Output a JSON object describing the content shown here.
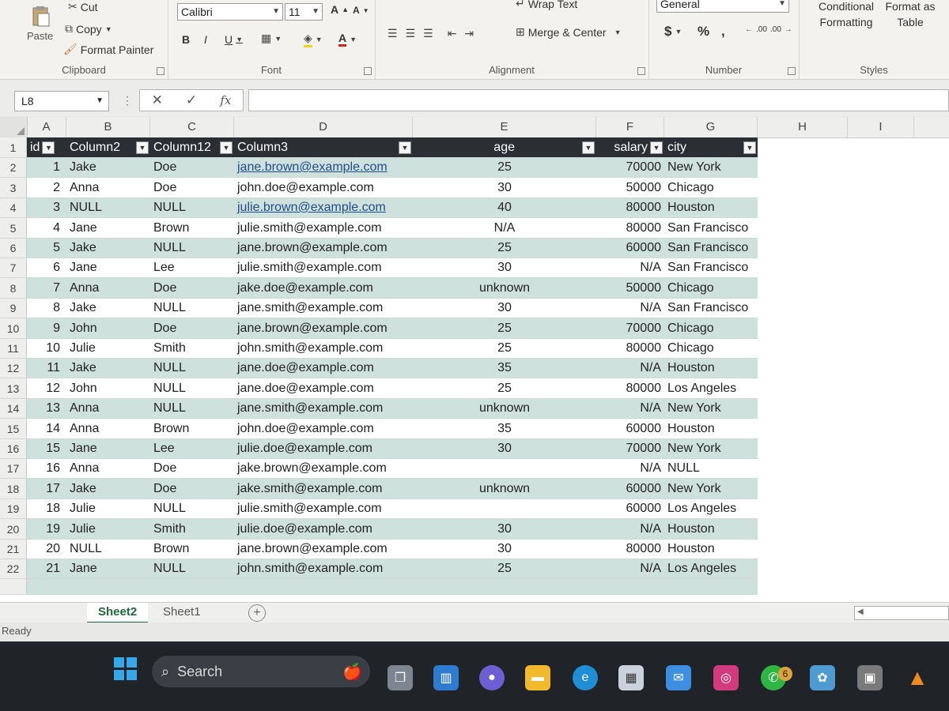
{
  "ribbon": {
    "clipboard": {
      "paste": "Paste",
      "cut": "Cut",
      "copy": "Copy",
      "format_painter": "Format Painter",
      "label": "Clipboard"
    },
    "font": {
      "name": "Calibri",
      "size": "11",
      "label": "Font",
      "bold": "B",
      "italic": "I",
      "underline": "U",
      "grow": "A",
      "shrink": "A",
      "font_color": "A"
    },
    "alignment": {
      "wrap_text": "Wrap Text",
      "merge_center": "Merge & Center",
      "label": "Alignment"
    },
    "number": {
      "format": "General",
      "currency": "$",
      "percent": "%",
      "comma": ",",
      "inc_decimal": ".00",
      "dec_decimal": ".00",
      "label": "Number"
    },
    "styles": {
      "conditional_formatting": "Conditional Formatting",
      "format_as_table": "Format as Table",
      "label": "Styles"
    }
  },
  "formula_bar": {
    "name_box": "L8",
    "cancel": "✕",
    "enter": "✓",
    "fx": "fx",
    "value": ""
  },
  "columns": [
    "A",
    "B",
    "C",
    "D",
    "E",
    "F",
    "G",
    "H",
    "I"
  ],
  "table": {
    "headers": {
      "id": "id",
      "col2": "Column2",
      "col12": "Column12",
      "col3": "Column3",
      "age": "age",
      "salary": "salary",
      "city": "city"
    },
    "rows": [
      {
        "n": "2",
        "id": "1",
        "c2": "Jake",
        "c12": "Doe",
        "email": "jane.brown@example.com",
        "age": "25",
        "salary": "70000",
        "city": "New York"
      },
      {
        "n": "3",
        "id": "2",
        "c2": "Anna",
        "c12": "Doe",
        "email": "john.doe@example.com",
        "age": "30",
        "salary": "50000",
        "city": "Chicago"
      },
      {
        "n": "4",
        "id": "3",
        "c2": "NULL",
        "c12": "NULL",
        "email": "julie.brown@example.com",
        "age": "40",
        "salary": "80000",
        "city": "Houston"
      },
      {
        "n": "5",
        "id": "4",
        "c2": "Jane",
        "c12": "Brown",
        "email": "julie.smith@example.com",
        "age": "N/A",
        "salary": "80000",
        "city": "San Francisco"
      },
      {
        "n": "6",
        "id": "5",
        "c2": "Jake",
        "c12": "NULL",
        "email": "jane.brown@example.com",
        "age": "25",
        "salary": "60000",
        "city": "San Francisco"
      },
      {
        "n": "7",
        "id": "6",
        "c2": "Jane",
        "c12": "Lee",
        "email": "julie.smith@example.com",
        "age": "30",
        "salary": "N/A",
        "city": "San Francisco"
      },
      {
        "n": "8",
        "id": "7",
        "c2": "Anna",
        "c12": "Doe",
        "email": "jake.doe@example.com",
        "age": "unknown",
        "salary": "50000",
        "city": "Chicago"
      },
      {
        "n": "9",
        "id": "8",
        "c2": "Jake",
        "c12": "NULL",
        "email": "jane.smith@example.com",
        "age": "30",
        "salary": "N/A",
        "city": "San Francisco"
      },
      {
        "n": "10",
        "id": "9",
        "c2": "John",
        "c12": "Doe",
        "email": "jane.brown@example.com",
        "age": "25",
        "salary": "70000",
        "city": "Chicago"
      },
      {
        "n": "11",
        "id": "10",
        "c2": "Julie",
        "c12": "Smith",
        "email": "john.smith@example.com",
        "age": "25",
        "salary": "80000",
        "city": "Chicago"
      },
      {
        "n": "12",
        "id": "11",
        "c2": "Jake",
        "c12": "NULL",
        "email": "jane.doe@example.com",
        "age": "35",
        "salary": "N/A",
        "city": "Houston"
      },
      {
        "n": "13",
        "id": "12",
        "c2": "John",
        "c12": "NULL",
        "email": "jane.doe@example.com",
        "age": "25",
        "salary": "80000",
        "city": "Los Angeles"
      },
      {
        "n": "14",
        "id": "13",
        "c2": "Anna",
        "c12": "NULL",
        "email": "jane.smith@example.com",
        "age": "unknown",
        "salary": "N/A",
        "city": "New York"
      },
      {
        "n": "15",
        "id": "14",
        "c2": "Anna",
        "c12": "Brown",
        "email": "john.doe@example.com",
        "age": "35",
        "salary": "60000",
        "city": "Houston"
      },
      {
        "n": "16",
        "id": "15",
        "c2": "Jane",
        "c12": "Lee",
        "email": "julie.doe@example.com",
        "age": "30",
        "salary": "70000",
        "city": "New York"
      },
      {
        "n": "17",
        "id": "16",
        "c2": "Anna",
        "c12": "Doe",
        "email": "jake.brown@example.com",
        "age": "",
        "salary": "N/A",
        "city": "NULL"
      },
      {
        "n": "18",
        "id": "17",
        "c2": "Jake",
        "c12": "Doe",
        "email": "jake.smith@example.com",
        "age": "unknown",
        "salary": "60000",
        "city": "New York"
      },
      {
        "n": "19",
        "id": "18",
        "c2": "Julie",
        "c12": "NULL",
        "email": "julie.smith@example.com",
        "age": "",
        "salary": "60000",
        "city": "Los Angeles"
      },
      {
        "n": "20",
        "id": "19",
        "c2": "Julie",
        "c12": "Smith",
        "email": "julie.doe@example.com",
        "age": "30",
        "salary": "N/A",
        "city": "Houston"
      },
      {
        "n": "21",
        "id": "20",
        "c2": "NULL",
        "c12": "Brown",
        "email": "jane.brown@example.com",
        "age": "30",
        "salary": "80000",
        "city": "Houston"
      },
      {
        "n": "22",
        "id": "21",
        "c2": "Jane",
        "c12": "NULL",
        "email": "john.smith@example.com",
        "age": "25",
        "salary": "N/A",
        "city": "Los Angeles"
      }
    ]
  },
  "sheets": {
    "active": "Sheet2",
    "other": "Sheet1",
    "add": "+"
  },
  "status": {
    "text": "Ready"
  },
  "taskbar": {
    "search": "Search",
    "whatsapp_badge": "6"
  },
  "colors": {
    "band": "#cfe1dd",
    "header": "#2b2f33",
    "excel_green": "#1d6b3a",
    "link": "#1f4e8a"
  }
}
